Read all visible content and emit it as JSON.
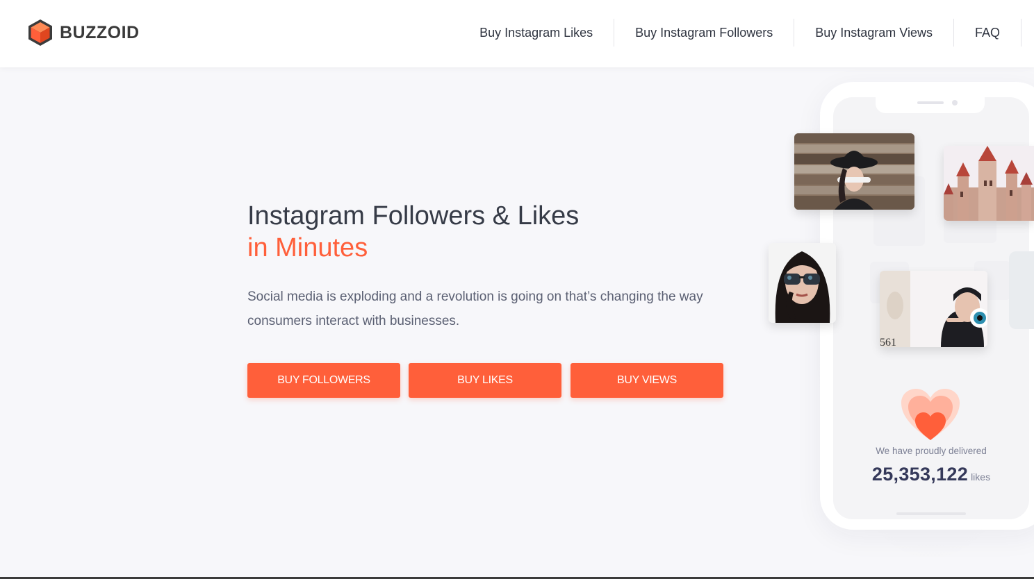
{
  "brand": {
    "name": "BUZZOID",
    "logo_icon": "hexagon-cube-icon",
    "accent": "#ff5f3a"
  },
  "nav": {
    "items": [
      {
        "label": "Buy Instagram Likes"
      },
      {
        "label": "Buy Instagram Followers"
      },
      {
        "label": "Buy Instagram Views"
      },
      {
        "label": "FAQ"
      }
    ]
  },
  "hero": {
    "title_line1": "Instagram Followers & Likes",
    "title_line2": "in Minutes",
    "description": "Social media is exploding and a revolution is going on that’s changing the way consumers interact with businesses.",
    "buttons": [
      {
        "label": "BUY FOLLOWERS"
      },
      {
        "label": "BUY LIKES"
      },
      {
        "label": "BUY VIEWS"
      }
    ]
  },
  "phone": {
    "photos": [
      "woman-hat-photo",
      "castle-photo",
      "woman-sunglasses-photo",
      "eye-photo"
    ],
    "stats_icon": "heart-icon",
    "delivered_text": "We have proudly delivered",
    "count": "25,353,122",
    "count_unit": "likes"
  }
}
